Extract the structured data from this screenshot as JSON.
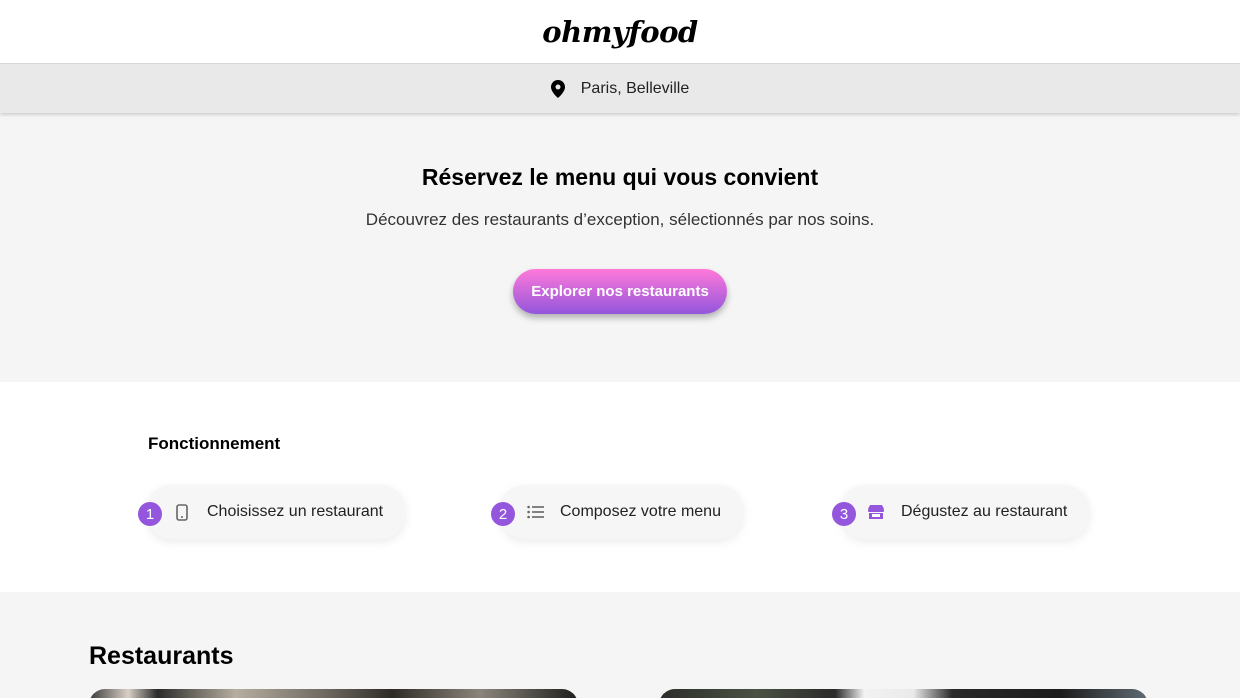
{
  "header": {
    "logo": "ohmyfood"
  },
  "location": {
    "icon": "location-pin-icon",
    "text": "Paris, Belleville"
  },
  "hero": {
    "title": "Réservez le menu qui vous convient",
    "subtitle": "Découvrez des restaurants d’exception, sélectionnés par nos soins.",
    "cta_label": "Explorer nos restaurants"
  },
  "how_it_works": {
    "title": "Fonctionnement",
    "steps": [
      {
        "number": "1",
        "icon": "mobile-phone-icon",
        "label": "Choisissez un restaurant"
      },
      {
        "number": "2",
        "icon": "list-icon",
        "label": "Composez votre menu"
      },
      {
        "number": "3",
        "icon": "store-icon",
        "label": "Dégustez au restaurant"
      }
    ]
  },
  "restaurants": {
    "title": "Restaurants"
  },
  "colors": {
    "accent": "#9356dc",
    "gradient_start": "#ff79da",
    "gradient_end": "#9356dc",
    "background_light": "#f5f5f5",
    "location_bar": "#e9e9e9"
  }
}
